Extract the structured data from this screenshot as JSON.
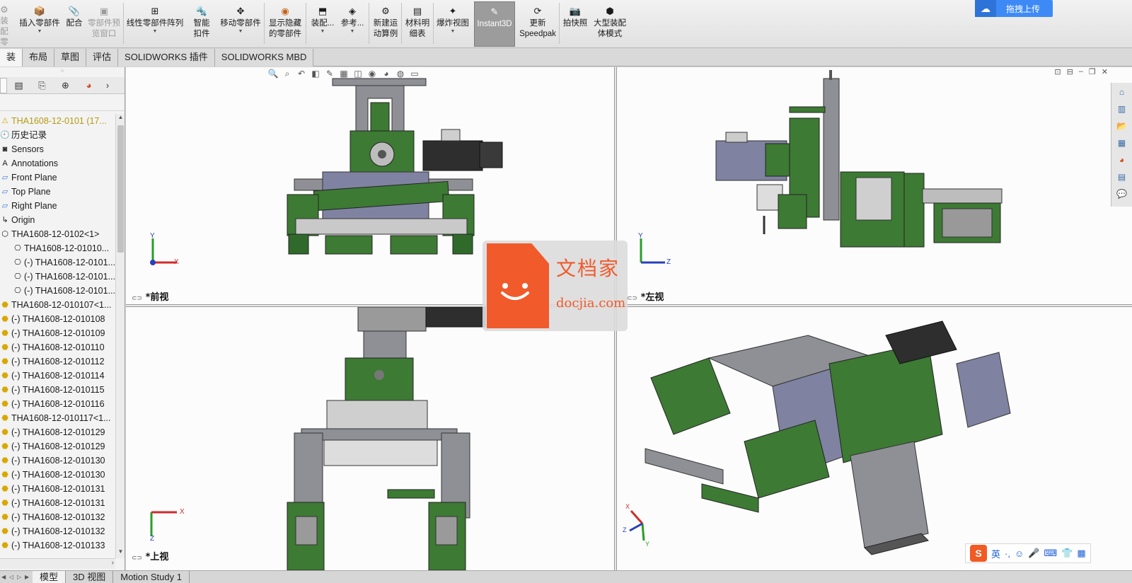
{
  "ribbon": {
    "items": [
      {
        "label": "装配零件",
        "icon": "component-icon",
        "state": "gray"
      },
      {
        "label": "插入零部件",
        "icon": "insert-component-icon"
      },
      {
        "label": "配合",
        "icon": "mate-icon"
      },
      {
        "label": "零部件预览窗口",
        "icon": "preview-window-icon",
        "state": "gray"
      },
      {
        "label": "线性零部件阵列",
        "icon": "linear-pattern-icon"
      },
      {
        "label": "智能扣件",
        "icon": "smart-fastener-icon"
      },
      {
        "label": "移动零部件",
        "icon": "move-component-icon"
      },
      {
        "label": "显示隐藏的零部件",
        "icon": "show-hidden-icon"
      },
      {
        "label": "装配...",
        "icon": "assembly-features-icon"
      },
      {
        "label": "参考...",
        "icon": "reference-geometry-icon"
      },
      {
        "label": "新建运动算例",
        "icon": "new-motion-study-icon"
      },
      {
        "label": "材料明细表",
        "icon": "bom-icon"
      },
      {
        "label": "爆炸视图",
        "icon": "exploded-view-icon"
      },
      {
        "label": "Instant3D",
        "icon": "instant3d-icon",
        "state": "active"
      },
      {
        "label": "更新Speedpak",
        "icon": "speedpak-icon"
      },
      {
        "label": "拍快照",
        "icon": "snapshot-icon"
      },
      {
        "label": "大型装配体模式",
        "icon": "large-assembly-icon"
      }
    ],
    "upload_label": "拖拽上传"
  },
  "tabs": [
    {
      "label": "装配体",
      "active": true
    },
    {
      "label": "布局"
    },
    {
      "label": "草图"
    },
    {
      "label": "评估"
    },
    {
      "label": "SOLIDWORKS 插件"
    },
    {
      "label": "SOLIDWORKS MBD"
    }
  ],
  "tree": {
    "items": [
      {
        "label": "THA1608-12-0101  (17...",
        "icon": "warning-icon",
        "warn": true
      },
      {
        "label": "历史记录",
        "icon": "history-icon"
      },
      {
        "label": "Sensors",
        "icon": "sensor-icon"
      },
      {
        "label": "Annotations",
        "icon": "annotation-icon"
      },
      {
        "label": "Front Plane",
        "icon": "plane-icon"
      },
      {
        "label": "Top Plane",
        "icon": "plane-icon"
      },
      {
        "label": "Right Plane",
        "icon": "plane-icon"
      },
      {
        "label": "Origin",
        "icon": "origin-icon"
      },
      {
        "label": "THA1608-12-0102<1>",
        "icon": "subassembly-icon"
      },
      {
        "label": "THA1608-12-01010...",
        "icon": "part-icon",
        "indent": true
      },
      {
        "label": "(-) THA1608-12-0101...",
        "icon": "part-icon",
        "indent": true
      },
      {
        "label": "(-) THA1608-12-0101...",
        "icon": "part-icon",
        "indent": true
      },
      {
        "label": "(-) THA1608-12-0101...",
        "icon": "part-icon",
        "indent": true
      },
      {
        "label": "THA1608-12-010107<1...",
        "icon": "part-yellow-icon"
      },
      {
        "label": "(-) THA1608-12-010108",
        "icon": "part-yellow-icon"
      },
      {
        "label": "(-) THA1608-12-010109",
        "icon": "part-yellow-icon"
      },
      {
        "label": "(-) THA1608-12-010110",
        "icon": "part-yellow-icon"
      },
      {
        "label": "(-) THA1608-12-010112",
        "icon": "part-yellow-icon"
      },
      {
        "label": "(-) THA1608-12-010114",
        "icon": "part-yellow-icon"
      },
      {
        "label": "(-) THA1608-12-010115",
        "icon": "part-yellow-icon"
      },
      {
        "label": "(-) THA1608-12-010116",
        "icon": "part-yellow-icon"
      },
      {
        "label": "THA1608-12-010117<1...",
        "icon": "part-yellow-icon"
      },
      {
        "label": "(-) THA1608-12-010129",
        "icon": "part-yellow-icon"
      },
      {
        "label": "(-) THA1608-12-010129",
        "icon": "part-yellow-icon"
      },
      {
        "label": "(-) THA1608-12-010130",
        "icon": "part-yellow-icon"
      },
      {
        "label": "(-) THA1608-12-010130",
        "icon": "part-yellow-icon"
      },
      {
        "label": "(-) THA1608-12-010131",
        "icon": "part-yellow-icon"
      },
      {
        "label": "(-) THA1608-12-010131",
        "icon": "part-yellow-icon"
      },
      {
        "label": "(-) THA1608-12-010132",
        "icon": "part-yellow-icon"
      },
      {
        "label": "(-) THA1608-12-010132",
        "icon": "part-yellow-icon"
      },
      {
        "label": "(-) THA1608-12-010133",
        "icon": "part-yellow-icon"
      }
    ]
  },
  "viewports": {
    "front": {
      "label": "*前视",
      "axis_y": "Y",
      "axis_x": "X"
    },
    "left": {
      "label": "*左视",
      "axis_y": "Y",
      "axis_x": "Z"
    },
    "top": {
      "label": "*上视",
      "axis_x": "X",
      "axis_z": "Z"
    },
    "iso": {
      "axis_x": "X",
      "axis_y": "Y",
      "axis_z": "Z"
    }
  },
  "watermark": {
    "brand": "文档家",
    "url": "docjia.com"
  },
  "bottom_tabs": [
    {
      "label": "模型",
      "active": true
    },
    {
      "label": "3D 视图"
    },
    {
      "label": "Motion Study 1"
    }
  ],
  "ime": {
    "mode": "英",
    "punct": "·,"
  },
  "colors": {
    "part_green": "#3d7a34",
    "part_gray": "#8f9096",
    "part_blue_gray": "#7f82a0",
    "dark": "#2e2e2e",
    "accent": "#3d8af7",
    "watermark": "#f15a2b"
  }
}
